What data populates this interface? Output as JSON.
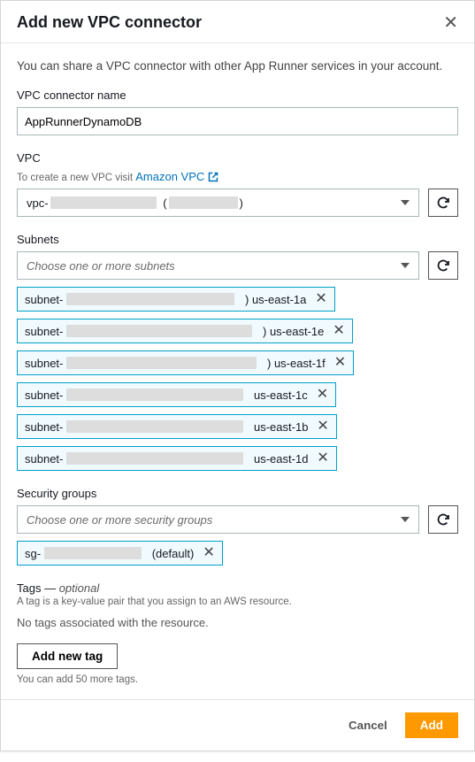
{
  "header": {
    "title": "Add new VPC connector"
  },
  "intro": "You can share a VPC connector with other App Runner services in your account.",
  "connectorName": {
    "label": "VPC connector name",
    "value": "AppRunnerDynamoDB"
  },
  "vpc": {
    "label": "VPC",
    "helperPrefix": "To create a new VPC visit ",
    "linkText": "Amazon VPC",
    "selectedPrefix": "vpc-",
    "selectedMid": "(",
    "selectedSuffix": ")"
  },
  "subnets": {
    "label": "Subnets",
    "placeholder": "Choose one or more subnets",
    "items": [
      {
        "prefix": "subnet-",
        "suffix": ") us-east-1a"
      },
      {
        "prefix": "subnet-",
        "suffix": ") us-east-1e"
      },
      {
        "prefix": "subnet-",
        "suffix": ") us-east-1f"
      },
      {
        "prefix": "subnet-",
        "suffix": "us-east-1c"
      },
      {
        "prefix": "subnet-",
        "suffix": "us-east-1b"
      },
      {
        "prefix": "subnet-",
        "suffix": "us-east-1d"
      }
    ]
  },
  "securityGroups": {
    "label": "Security groups",
    "placeholder": "Choose one or more security groups",
    "items": [
      {
        "prefix": "sg-",
        "suffix": "(default)"
      }
    ]
  },
  "tags": {
    "title": "Tags",
    "dash": " — ",
    "optional": "optional",
    "desc": "A tag is a key-value pair that you assign to an AWS resource.",
    "empty": "No tags associated with the resource.",
    "addBtn": "Add new tag",
    "hint": "You can add 50 more tags."
  },
  "footer": {
    "cancel": "Cancel",
    "add": "Add"
  }
}
